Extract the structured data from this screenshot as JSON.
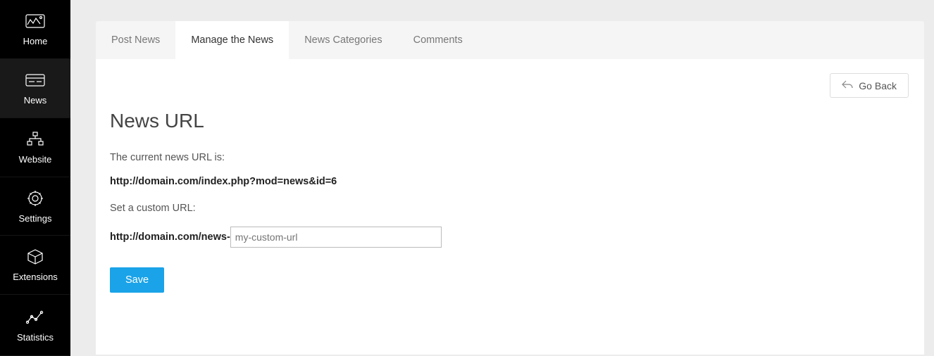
{
  "sidebar": {
    "items": [
      {
        "label": "Home"
      },
      {
        "label": "News"
      },
      {
        "label": "Website"
      },
      {
        "label": "Settings"
      },
      {
        "label": "Extensions"
      },
      {
        "label": "Statistics"
      }
    ]
  },
  "tabs": [
    {
      "label": "Post News"
    },
    {
      "label": "Manage the News"
    },
    {
      "label": "News Categories"
    },
    {
      "label": "Comments"
    }
  ],
  "goback_label": "Go Back",
  "page": {
    "title": "News URL",
    "current_label": "The current news URL is:",
    "current_url": "http://domain.com/index.php?mod=news&id=6",
    "set_label": "Set a custom URL:",
    "prefix": "http://domain.com/news-",
    "input_placeholder": "my-custom-url",
    "save_label": "Save"
  }
}
